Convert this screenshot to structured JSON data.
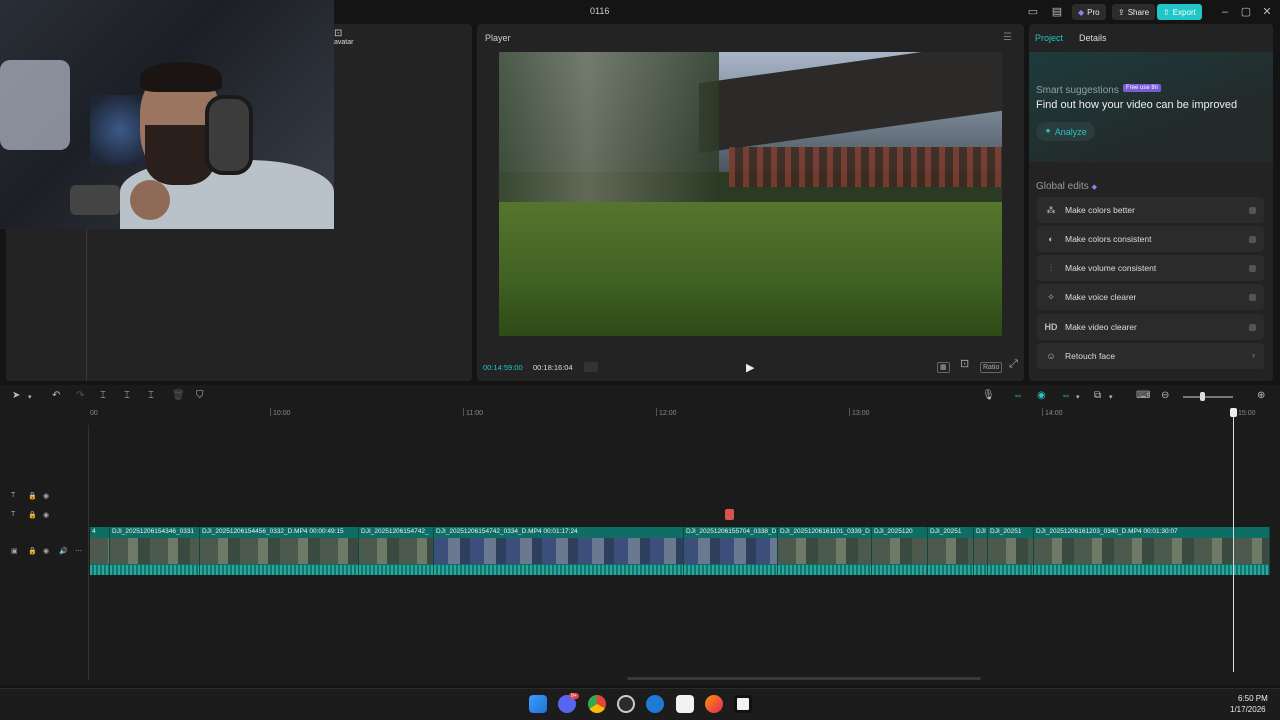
{
  "window": {
    "title": "0116"
  },
  "titlebar": {
    "pro_label": "Pro",
    "share_label": "Share",
    "export_label": "Export",
    "accent": "#21c6c6"
  },
  "left_panel": {
    "avatar_label": "avatar"
  },
  "player": {
    "title": "Player",
    "current_time": "00:14:59:00",
    "total_time": "00:18:16:04",
    "controls": [
      "Ratio"
    ]
  },
  "right_panel": {
    "tabs": [
      "Project",
      "Details"
    ],
    "smart_suggestions_label": "Smart suggestions",
    "free_badge": "Free use thi",
    "headline": "Find out how your video can be improved",
    "analyze_label": "Analyze",
    "global_edits_label": "Global edits",
    "global_edits": [
      {
        "label": "Make colors better",
        "icon": "wand-icon"
      },
      {
        "label": "Make colors consistent",
        "icon": "palette-icon"
      },
      {
        "label": "Make volume consistent",
        "icon": "sliders-icon"
      },
      {
        "label": "Make voice clearer",
        "icon": "sparkle-icon"
      },
      {
        "label": "Make video clearer",
        "icon": "hd-icon"
      },
      {
        "label": "Retouch face",
        "icon": "face-icon"
      }
    ],
    "hd_text": "HD"
  },
  "timeline": {
    "ruler_labels": [
      "00",
      "10:00",
      "11:00",
      "12:00",
      "13:00",
      "14:00",
      "15:00"
    ],
    "clips": [
      {
        "label": "4"
      },
      {
        "label": "DJI_20251206154346_0331"
      },
      {
        "label": "DJI_20251206154456_0332_D.MP4   00:00:49:15"
      },
      {
        "label": "DJI_20251206154742_"
      },
      {
        "label": "DJI_20251206154742_0334_D.MP4   00:01:17:24"
      },
      {
        "label": "DJI_20251206155704_0338_D"
      },
      {
        "label": "DJI_20251206161101_0339_D"
      },
      {
        "label": "DJI_2025120"
      },
      {
        "label": "DJI_20251"
      },
      {
        "label": "DJI"
      },
      {
        "label": "DJI_20251"
      },
      {
        "label": "DJI_20251206161203_0340_D.MP4   00:01:30:07"
      }
    ]
  },
  "taskbar": {
    "time": "6:50 PM",
    "date": "1/17/2026",
    "discord_badge": "9+"
  }
}
